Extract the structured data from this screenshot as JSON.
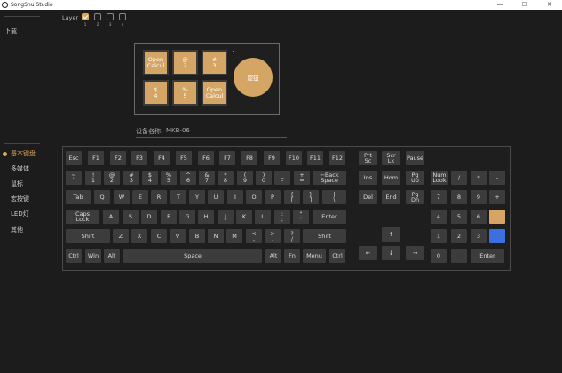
{
  "window": {
    "title": "SongShu Studio",
    "minimize": "—",
    "maximize": "☐",
    "close": "✕"
  },
  "sidebar": {
    "top_item": "下载",
    "items": [
      "基本键盘",
      "多媒体",
      "鼠标",
      "宏按键",
      "LED灯",
      "其他"
    ],
    "active_index": 0
  },
  "layers": {
    "label": "Layer",
    "numbers": [
      "1",
      "2",
      "3",
      "4"
    ],
    "checked": 0
  },
  "device": {
    "keys": [
      "Open\nCalcul",
      "@\n2",
      "#\n3",
      "$\n4",
      "%\n5",
      "Open\nCalcul"
    ],
    "knob_label": "旋钮",
    "name_label": "设备名称:",
    "name_value": "MKB-06"
  },
  "keyboard": {
    "keys": [
      "Esc",
      "F1",
      "F2",
      "F3",
      "F4",
      "F5",
      "F6",
      "F7",
      "F8",
      "F9",
      "F10",
      "F11",
      "F12",
      "~\n`",
      "!\n1",
      "@\n2",
      "#\n3",
      "$\n4",
      "%\n5",
      "^\n6",
      "&\n7",
      "*\n8",
      "(\n9",
      ")\n0",
      "_\n-",
      "+\n=",
      "←Back\nSpace",
      "Tab",
      "Q",
      "W",
      "E",
      "R",
      "T",
      "Y",
      "U",
      "I",
      "O",
      "P",
      "{\n[",
      "}\n]",
      "|\n\\",
      "Caps\nLock",
      "A",
      "S",
      "D",
      "F",
      "G",
      "H",
      "J",
      "K",
      "L",
      ":\n;",
      "\"\n'",
      "Enter",
      "Shift",
      "Z",
      "X",
      "C",
      "V",
      "B",
      "N",
      "M",
      "<\n,",
      ">\n.",
      "?\n/",
      "Shift",
      "Ctrl",
      "Win",
      "Alt",
      "Space",
      "Alt",
      "Fn",
      "Menu",
      "Ctrl",
      "Prt\nSc",
      "Scr\nLk",
      "Pause",
      "Ins",
      "Hom",
      "Pg\nUp",
      "Del",
      "End",
      "Pg\nDn",
      "↑",
      "←",
      "↓",
      "→",
      "Num\nLook",
      "/",
      "*",
      "-",
      "7",
      "8",
      "9",
      "+",
      "4",
      "5",
      "6",
      "",
      "1",
      "2",
      "3",
      "",
      "0",
      "",
      "Enter"
    ]
  },
  "colors": {
    "accent": "#d4a564",
    "selected_blue": "#3d6fe0",
    "key_bg": "#3c3c3c",
    "background": "#1c1c1c"
  }
}
